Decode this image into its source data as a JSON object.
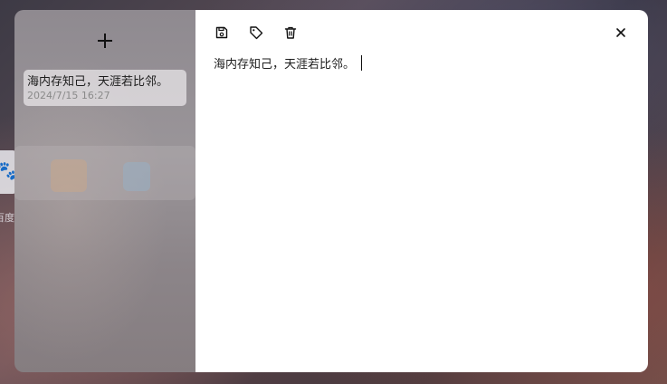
{
  "background": {
    "label": "百度"
  },
  "sidebar": {
    "add_icon": "plus-icon",
    "notes": [
      {
        "title": "海内存知己，天涯若比邻。",
        "date": "2024/7/15 16:27"
      }
    ]
  },
  "toolbar": {
    "icons": [
      "save-icon",
      "tag-icon",
      "trash-icon",
      "close-icon"
    ]
  },
  "editor": {
    "content": "海内存知己，天涯若比邻。"
  },
  "colors": {
    "sidebar_bg": "#948e92",
    "card_bg": "#ebe9ec",
    "editor_bg": "#ffffff",
    "text": "#1c1c1c",
    "date_text": "#8a8a8a"
  }
}
